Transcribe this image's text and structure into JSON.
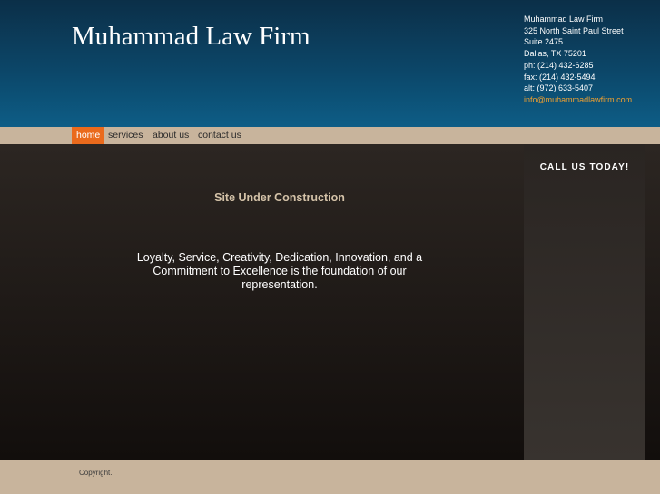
{
  "header": {
    "site_title": "Muhammad Law Firm",
    "contact": {
      "name": "Muhammad Law Firm",
      "address_line1": "325 North Saint Paul Street",
      "address_line2": "Suite 2475",
      "city_state_zip": "Dallas, TX 75201",
      "phone": "ph: (214) 432-6285",
      "fax": "fax: (214) 432-5494",
      "alt": "alt: (972) 633-5407",
      "email": "info@muhammadlawfirm.com"
    }
  },
  "nav": {
    "items": [
      {
        "label": "home",
        "active": true
      },
      {
        "label": "services",
        "active": false
      },
      {
        "label": "about us",
        "active": false
      },
      {
        "label": "contact us",
        "active": false
      }
    ]
  },
  "main": {
    "construction_notice": "Site Under Construction",
    "mission_statement": "Loyalty, Service, Creativity, Dedication, Innovation, and a Commitment to Excellence is the  foundation  of  our representation."
  },
  "sidebar": {
    "heading": "CALL US TODAY!"
  },
  "footer": {
    "copyright": "Copyright."
  },
  "colors": {
    "header_dark": "#0b2f48",
    "header_light": "#0d5d86",
    "nav_bar": "#c8b49c",
    "nav_active": "#ea6a1c",
    "accent_email": "#f0a030",
    "construction_text": "#d4c2a8"
  }
}
